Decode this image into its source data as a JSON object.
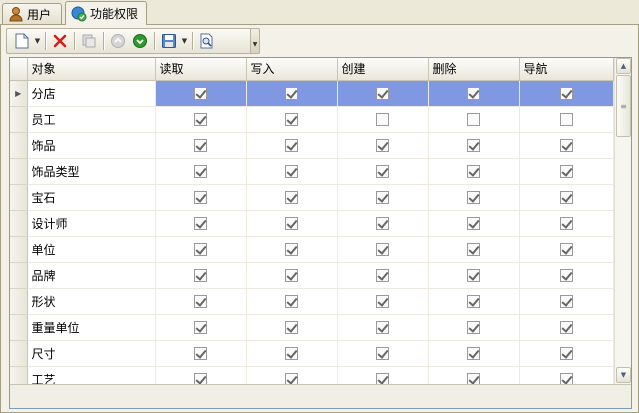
{
  "tabs": [
    {
      "label": "用户",
      "icon": "user-icon",
      "active": false
    },
    {
      "label": "功能权限",
      "icon": "shield-check-icon",
      "active": true
    }
  ],
  "toolbar": {
    "buttons": [
      "new-document-icon",
      "delete-icon",
      "copy-icon",
      "up-icon",
      "down-icon",
      "save-icon",
      "preview-icon"
    ]
  },
  "grid": {
    "columns": [
      "对象",
      "读取",
      "写入",
      "创建",
      "删除",
      "导航"
    ],
    "selected_row": 0,
    "rows": [
      {
        "name": "分店",
        "perms": [
          true,
          true,
          true,
          true,
          true
        ]
      },
      {
        "name": "员工",
        "perms": [
          true,
          true,
          false,
          false,
          false
        ]
      },
      {
        "name": "饰品",
        "perms": [
          true,
          true,
          true,
          true,
          true
        ]
      },
      {
        "name": "饰品类型",
        "perms": [
          true,
          true,
          true,
          true,
          true
        ]
      },
      {
        "name": "宝石",
        "perms": [
          true,
          true,
          true,
          true,
          true
        ]
      },
      {
        "name": "设计师",
        "perms": [
          true,
          true,
          true,
          true,
          true
        ]
      },
      {
        "name": "单位",
        "perms": [
          true,
          true,
          true,
          true,
          true
        ]
      },
      {
        "name": "品牌",
        "perms": [
          true,
          true,
          true,
          true,
          true
        ]
      },
      {
        "name": "形状",
        "perms": [
          true,
          true,
          true,
          true,
          true
        ]
      },
      {
        "name": "重量单位",
        "perms": [
          true,
          true,
          true,
          true,
          true
        ]
      },
      {
        "name": "尺寸",
        "perms": [
          true,
          true,
          true,
          true,
          true
        ]
      },
      {
        "name": "工艺",
        "perms": [
          true,
          true,
          true,
          true,
          true
        ]
      }
    ]
  },
  "colors": {
    "selection": "#7f98e1",
    "delete": "#d0201a",
    "arrow_green": "#2e9a2e"
  }
}
